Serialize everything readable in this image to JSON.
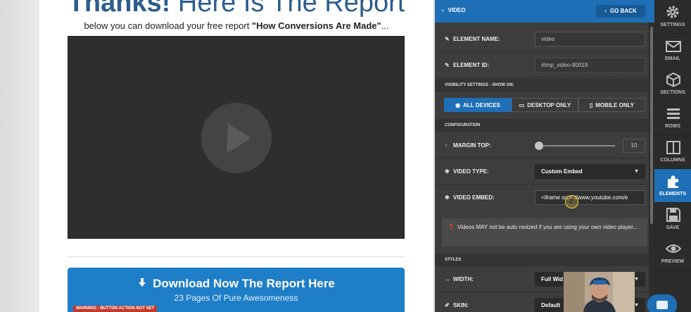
{
  "canvas": {
    "headline_bold": "Thanks!",
    "headline_rest": " Here Is The Report",
    "subline_prefix": "below you can download your free report ",
    "subline_bold": "\"How Conversions Are Made\"",
    "subline_suffix": "...",
    "cta_main": "Download Now The Report Here",
    "cta_sub": "23 Pages Of Pure Awesomeness",
    "warning": "WARNING : BUTTON ACTION NOT SET"
  },
  "panel": {
    "title": "VIDEO",
    "back_label": "GO BACK",
    "element_name_label": "ELEMENT NAME:",
    "element_name_value": "video",
    "element_id_label": "ELEMENT ID:",
    "element_id_value": "#tmp_video-80019",
    "visibility_header": "VISIBILITY SETTINGS - SHOW ON:",
    "visibility_options": [
      "ALL DEVICES",
      "DESKTOP ONLY",
      "MOBILE ONLY"
    ],
    "visibility_selected": "ALL DEVICES",
    "configuration_header": "CONFIGURATION",
    "margin_top_label": "MARGIN TOP:",
    "margin_top_value": "10",
    "margin_top_fraction": 0.0,
    "video_type_label": "VIDEO TYPE:",
    "video_type_value": "Custom Embed",
    "video_embed_label": "VIDEO EMBED:",
    "video_embed_value": "<iframe src=\"//www.youtube.com/e",
    "note": "Videos MAY not be auto resized if you are using your own video player...",
    "styles_header": "STYLES",
    "width_label": "WIDTH:",
    "width_value": "Full Wid",
    "skin_label": "SKIN:",
    "skin_value": "Default"
  },
  "rail": {
    "items": [
      {
        "label": "SETTINGS",
        "icon": "gear-icon"
      },
      {
        "label": "EMAIL",
        "icon": "envelope-icon"
      },
      {
        "label": "SECTIONS",
        "icon": "cube-icon"
      },
      {
        "label": "ROWS",
        "icon": "rows-icon"
      },
      {
        "label": "COLUMNS",
        "icon": "columns-icon"
      },
      {
        "label": "ELEMENTS",
        "icon": "puzzle-icon"
      },
      {
        "label": "SAVE",
        "icon": "floppy-icon"
      },
      {
        "label": "PREVIEW",
        "icon": "eye-icon"
      }
    ],
    "active": "ELEMENTS"
  },
  "colors": {
    "accent": "#1e6fb5",
    "cta": "#1e7ec8",
    "headline": "#2c5d8c",
    "warning": "#c0392b"
  }
}
